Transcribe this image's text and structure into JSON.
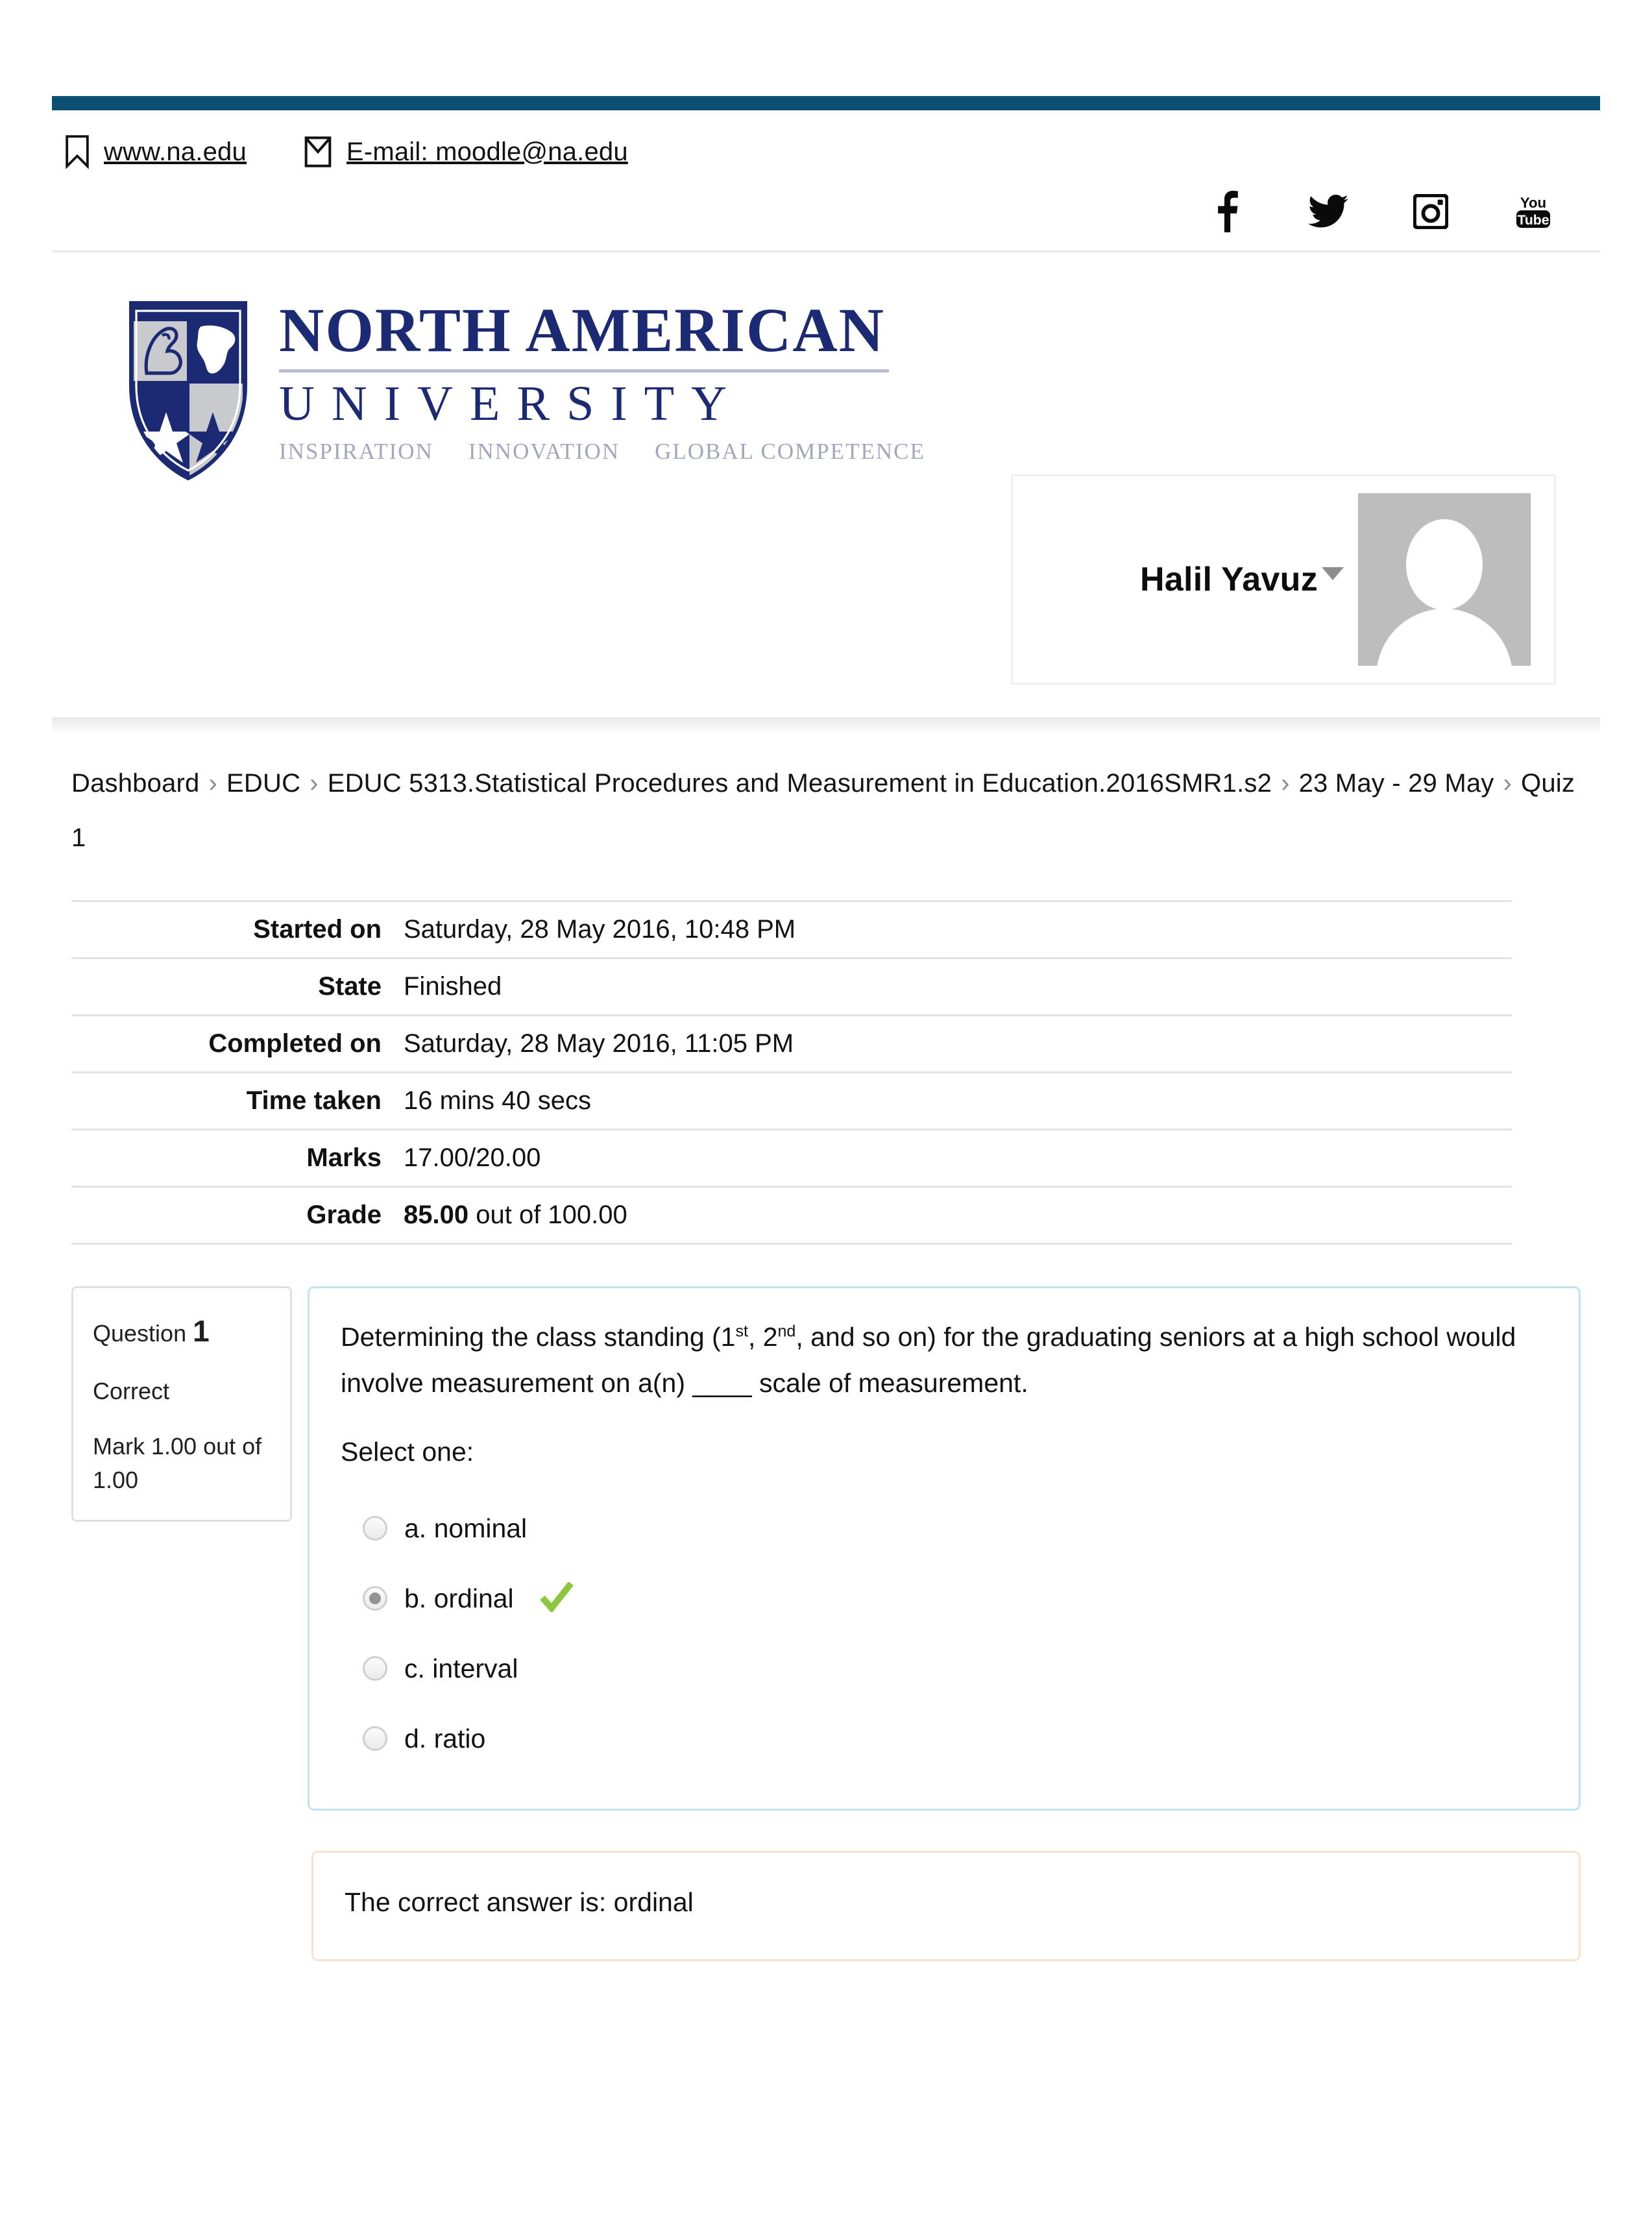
{
  "header": {
    "contact": [
      {
        "icon": "bookmark-icon",
        "text": "www.na.edu"
      },
      {
        "icon": "envelope-icon",
        "text": "E-mail: moodle@na.edu"
      }
    ],
    "social": [
      {
        "icon": "facebook-icon",
        "label": "Facebook"
      },
      {
        "icon": "twitter-icon",
        "label": "Twitter"
      },
      {
        "icon": "instagram-icon",
        "label": "Instagram"
      },
      {
        "icon": "youtube-icon",
        "label": "YouTube"
      }
    ],
    "logo": {
      "line1": "NORTH AMERICAN",
      "line2": "UNIVERSITY",
      "tagline": [
        "INSPIRATION",
        "INNOVATION",
        "GLOBAL COMPETENCE"
      ],
      "brand_color": "#1c2a73"
    },
    "user": {
      "name": "Halil Yavuz",
      "avatar_alt": "user-avatar-placeholder"
    },
    "accent_bar_color": "#0b4f72"
  },
  "breadcrumb": {
    "separator": "›",
    "items": [
      "Dashboard",
      "EDUC",
      "EDUC 5313.Statistical Procedures and Measurement in Education.2016SMR1.s2",
      "23 May - 29 May",
      "Quiz 1"
    ]
  },
  "summary": {
    "rows": [
      {
        "label": "Started on",
        "value": "Saturday, 28 May 2016, 10:48 PM"
      },
      {
        "label": "State",
        "value": "Finished"
      },
      {
        "label": "Completed on",
        "value": "Saturday, 28 May 2016, 11:05 PM"
      },
      {
        "label": "Time taken",
        "value": "16 mins 40 secs"
      },
      {
        "label": "Marks",
        "value": "17.00/20.00"
      }
    ],
    "grade": {
      "label": "Grade",
      "value_bold": "85.00",
      "value_rest": " out of 100.00"
    }
  },
  "question": {
    "info": {
      "question_word": "Question",
      "number": "1",
      "state": "Correct",
      "mark": "Mark 1.00 out of 1.00"
    },
    "text_part1": "Determining the class standing (1",
    "sup1": "st",
    "text_part2": ", 2",
    "sup2": "nd",
    "text_part3": ", and so on) for the graduating seniors at a high school would involve measurement on a(n) ____ scale of measurement.",
    "select_prompt": "Select one:",
    "options": [
      {
        "label": "a. nominal",
        "selected": false,
        "correct_mark": false
      },
      {
        "label": "b. ordinal",
        "selected": true,
        "correct_mark": true
      },
      {
        "label": "c. interval",
        "selected": false,
        "correct_mark": false
      },
      {
        "label": "d. ratio",
        "selected": false,
        "correct_mark": false
      }
    ],
    "correct_tick_color": "#8dc63f",
    "border_color": "#bfe4ef"
  },
  "feedback": {
    "text": "The correct answer is: ordinal",
    "border_color": "#f6e3c8"
  }
}
